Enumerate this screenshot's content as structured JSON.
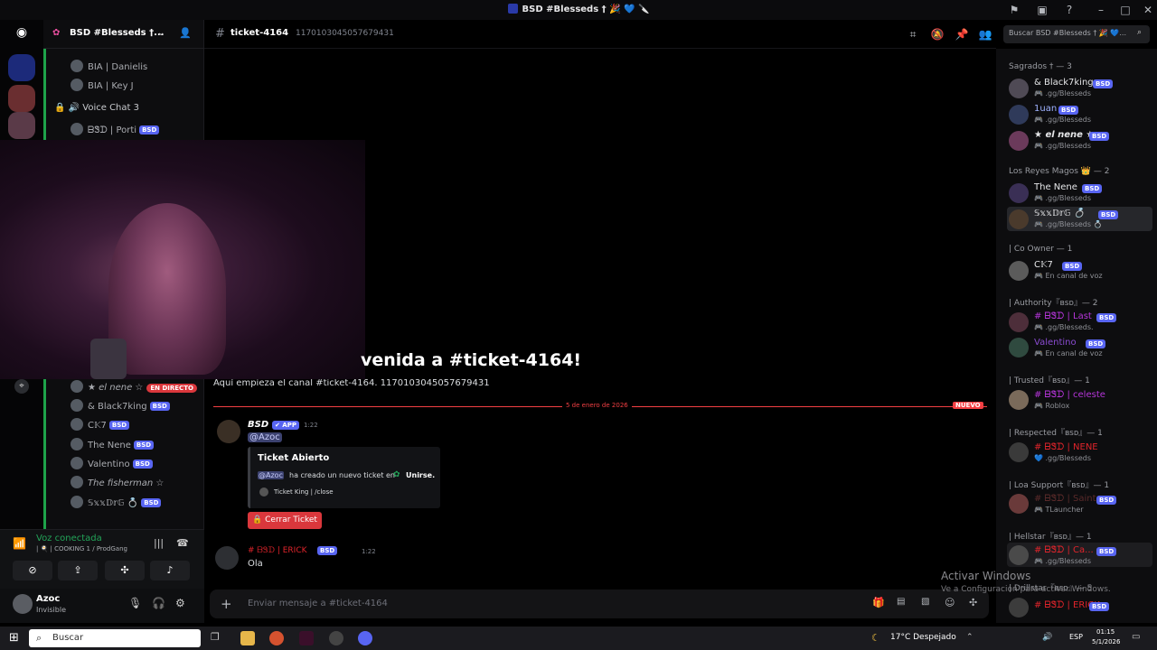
{
  "window": {
    "title": "BSD #Blesseds † 🎉 💙 🔪"
  },
  "server": {
    "name": "BSD #Blesseds †..."
  },
  "channels": [
    {
      "label": "BIA | Danielis"
    },
    {
      "label": "BIA | Key J"
    },
    {
      "label": "Voice Chat 3"
    },
    {
      "label": "ᗷᏕᗪ | Porti"
    }
  ],
  "voice_members": [
    {
      "name": "★ el nene ☆",
      "live": "EN DIRECTO"
    },
    {
      "name": "& Black7king"
    },
    {
      "name": "C𝕂7"
    },
    {
      "name": "The Nene"
    },
    {
      "name": "Valentino"
    },
    {
      "name": "The fisherman ☆"
    },
    {
      "name": "𝕊𝕩𝕩𝔻𝕣𝔾 💍"
    }
  ],
  "voice_status": {
    "title": "Voz conectada",
    "sub": "| 🍳 | COOKING 1 / ProdGang"
  },
  "user": {
    "name": "Azoc",
    "status": "Invisible"
  },
  "channel": {
    "name": "ticket-4164",
    "id": "1170103045057679431"
  },
  "welcome": {
    "title": "venida a #ticket-4164!",
    "sub": "Aquí empieza el canal #ticket-4164. 1170103045057679431"
  },
  "divider": {
    "date": "5 de enero de 2026",
    "new": "NUEVO"
  },
  "messages": [
    {
      "author": "BSD",
      "app": "✔ APP",
      "time": "1:22",
      "mention": "@Azoc"
    },
    {
      "author": "# ᗷᏕᗪ | ERICK",
      "tag": "BSD",
      "time": "1:22",
      "text": "Ola"
    }
  ],
  "embed": {
    "title": "Ticket Abierto",
    "mention": "@Azoc",
    "body": "ha creado un nuevo ticket en",
    "target": "Unirse.",
    "footer": "Ticket King | /close"
  },
  "close_button": "🔒 Cerrar Ticket",
  "input": {
    "placeholder": "Enviar mensaje a #ticket-4164"
  },
  "search": {
    "placeholder": "Buscar BSD #Blesseds † 🎉 💙..."
  },
  "groups": [
    {
      "label": "Sagrados † — 3"
    },
    {
      "label": "Los Reyes Magos 👑 — 2"
    },
    {
      "label": "| Co Owner — 1"
    },
    {
      "label": "| Authority『ʙsᴅ』— 2"
    },
    {
      "label": "| Trusted『ʙsᴅ』— 1"
    },
    {
      "label": "| Respected『ʙsᴅ』— 1"
    },
    {
      "label": "| Loa Support『ʙsᴅ』— 1"
    },
    {
      "label": "| Hellstar『ʙsᴅ』— 1"
    },
    {
      "label": "| Drillstar『ʙsᴅ』— 5"
    }
  ],
  "members": [
    {
      "name": "& Black7king",
      "sub": "🎮 .gg/Blesseds"
    },
    {
      "name": "1uan",
      "sub": "🎮 .gg/Blesseds"
    },
    {
      "name": "★ el nene ★",
      "sub": "🎮 .gg/Blesseds"
    },
    {
      "name": "The Nene",
      "sub": "🎮 .gg/Blesseds"
    },
    {
      "name": "𝕊𝕩𝕩𝔻𝕣𝔾 💍",
      "sub": "🎮 .gg/Blesseds 💍"
    },
    {
      "name": "C𝕂7",
      "sub": "🎮 En canal de voz"
    },
    {
      "name": "# ᗷᏕᗪ | Last",
      "sub": "🎮 .gg/Blesseds."
    },
    {
      "name": "Valentino",
      "sub": "🎮 En canal de voz"
    },
    {
      "name": "# ᗷᏕᗪ | celeste",
      "sub": "🎮 Roblox"
    },
    {
      "name": "# ᗷᏕᗪ | NENE",
      "sub": "💙 .gg/Blesseds"
    },
    {
      "name": "# ᗷᏕᗪ | Saint",
      "sub": "🎮 TLauncher"
    },
    {
      "name": "# ᗷᏕᗪ | Ca...",
      "sub": "🎮 .gg/Blesseds"
    },
    {
      "name": "# ᗷᏕᗪ | ERICK",
      "sub": ""
    }
  ],
  "watermark": {
    "line1": "Activar Windows",
    "line2": "Ve a Configuración para activar Windows."
  },
  "taskbar": {
    "search": "Buscar",
    "weather": "17°C  Despejado",
    "lang": "ESP",
    "time": "01:15",
    "date": "5/1/2026"
  },
  "colors": {
    "accent": "#5865f2",
    "danger": "#da373c",
    "voice": "#23a559",
    "red_name": "#e0242b"
  }
}
